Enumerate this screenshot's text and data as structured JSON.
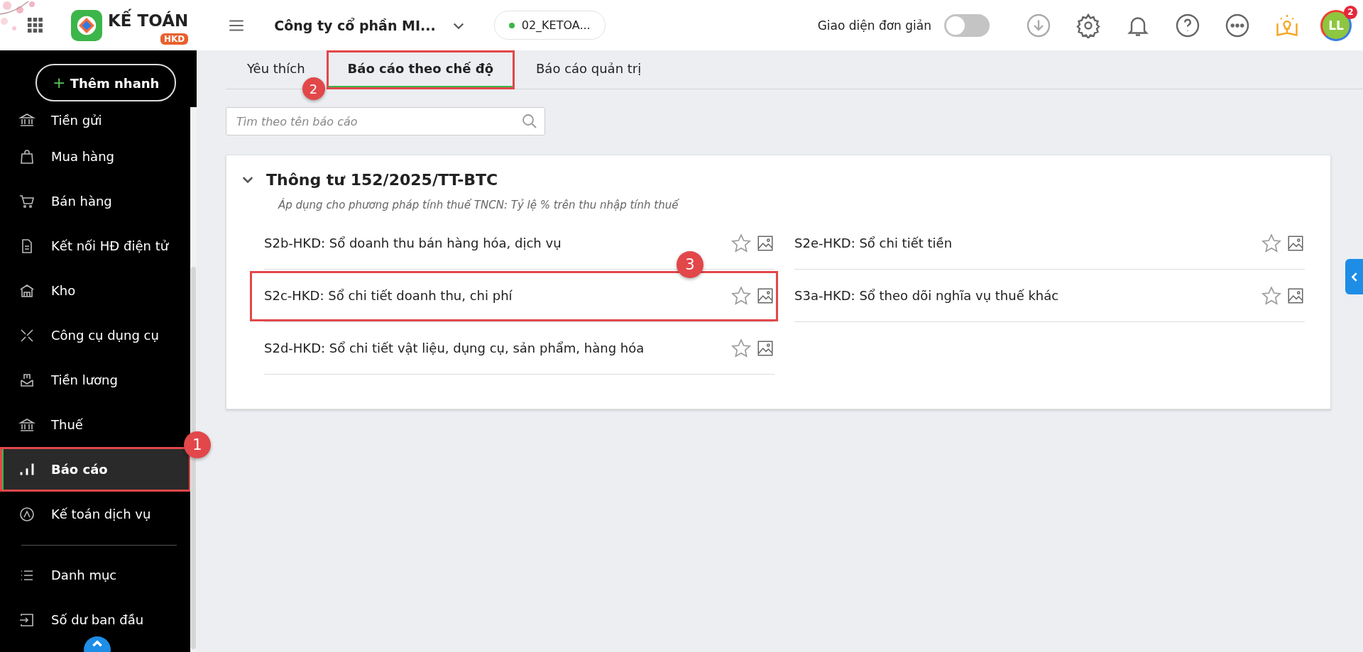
{
  "header": {
    "logo_text": "KẾ TOÁN",
    "logo_badge": "HKD",
    "company": "Công ty cổ phần MI...",
    "database": "02_KETOA...",
    "simple_mode": {
      "label": "Giao diện đơn giản",
      "on": false
    },
    "avatar": {
      "initials": "LL",
      "badge": "2"
    }
  },
  "sidebar": {
    "quick_add": {
      "icon": "+",
      "label": "Thêm nhanh"
    },
    "items": [
      {
        "label": "Tiền gửi",
        "selected": false
      },
      {
        "label": "Mua hàng",
        "selected": false
      },
      {
        "label": "Bán hàng",
        "selected": false
      },
      {
        "label": "Kết nối HĐ điện tử",
        "selected": false
      },
      {
        "label": "Kho",
        "selected": false
      },
      {
        "label": "Công cụ dụng cụ",
        "selected": false
      },
      {
        "label": "Tiền lương",
        "selected": false
      },
      {
        "label": "Thuế",
        "selected": false
      },
      {
        "label": "Báo cáo",
        "selected": true,
        "callout": "1"
      },
      {
        "label": "Kế toán dịch vụ",
        "selected": false
      }
    ],
    "bottom_items": [
      {
        "label": "Danh mục"
      },
      {
        "label": "Số dư ban đầu"
      }
    ]
  },
  "tabs": [
    {
      "label": "Yêu thích",
      "selected": false
    },
    {
      "label": "Báo cáo theo chế độ",
      "selected": true,
      "callout": "2"
    },
    {
      "label": "Báo cáo quản trị",
      "selected": false
    }
  ],
  "search": {
    "placeholder": "Tìm theo tên báo cáo"
  },
  "section": {
    "title": "Thông tư 152/2025/TT-BTC",
    "expanded": true,
    "note": "Áp dụng cho phương pháp tính thuế TNCN: Tỷ lệ % trên thu nhập tính thuế",
    "columns": [
      [
        {
          "name": "S2b-HKD: Sổ doanh thu bán hàng hóa, dịch vụ",
          "favorite": false
        },
        {
          "name": "S2c-HKD: Sổ chi tiết doanh thu, chi phí",
          "favorite": false,
          "callout": "3"
        },
        {
          "name": "S2d-HKD: Sổ chi tiết vật liệu, dụng cụ, sản phẩm, hàng hóa",
          "favorite": false
        }
      ],
      [
        {
          "name": "S2e-HKD: Sổ chi tiết tiền",
          "favorite": false
        },
        {
          "name": "S3a-HKD: Sổ theo dõi nghĩa vụ thuế khác",
          "favorite": false
        }
      ]
    ]
  }
}
